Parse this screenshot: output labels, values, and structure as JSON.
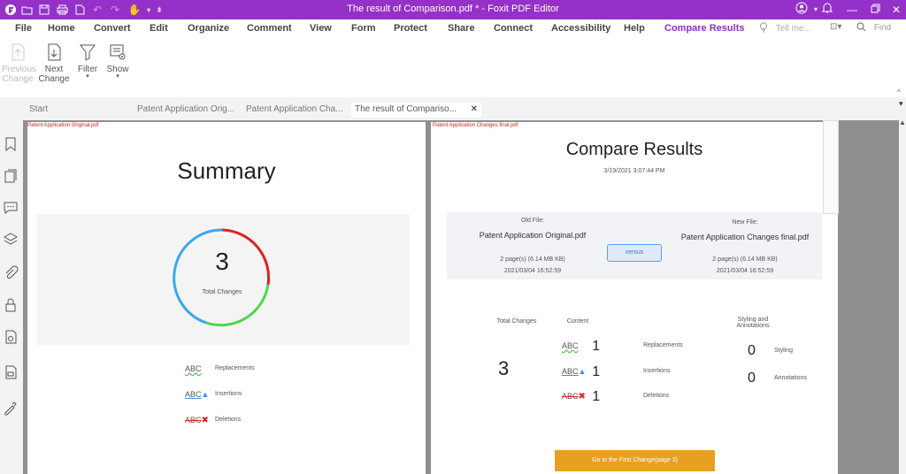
{
  "window": {
    "title": "The result of Comparison.pdf * - Foxit PDF Editor"
  },
  "menu": {
    "items": [
      "File",
      "Home",
      "Convert",
      "Edit",
      "Organize",
      "Comment",
      "View",
      "Form",
      "Protect",
      "Share",
      "Connect",
      "Accessibility",
      "Help",
      "Compare Results"
    ],
    "tell_me": "Tell me...",
    "find": "Find"
  },
  "ribbon": {
    "previous_change": [
      "Previous",
      "Change"
    ],
    "next_change": [
      "Next",
      "Change"
    ],
    "filter": "Filter",
    "show": "Show"
  },
  "tabs": [
    {
      "label": "Start"
    },
    {
      "label": "Patent Application Orig..."
    },
    {
      "label": "Patent Application Cha..."
    },
    {
      "label": "The result of Compariso..."
    }
  ],
  "page1": {
    "file_label": "Patent Application Original.pdf",
    "title": "Summary",
    "total": "3",
    "total_label": "Total Changes",
    "legend": [
      {
        "abc": "ABC",
        "label": "Replacements"
      },
      {
        "abc": "ABC",
        "label": "Insertions"
      },
      {
        "abc": "ABC",
        "label": "Deletions"
      }
    ],
    "colors": {
      "replacement": "#2ebd2e",
      "insertion": "#3a8ee6",
      "deletion": "#e02020"
    }
  },
  "page2": {
    "file_label": "Patent Application Changes final.pdf",
    "title": "Compare Results",
    "date": "3/19/2021 3:07:44 PM",
    "old_file": {
      "heading": "Old File:",
      "name": "Patent Application Original.pdf",
      "pages": "2 page(s) (6.14 MB KB)",
      "date": "2021/03/04 16:52:59"
    },
    "new_file": {
      "heading": "New File:",
      "name": "Patent Application Changes final.pdf",
      "pages": "2 page(s) (6.14 MB KB)",
      "date": "2021/03/04 16:52:59"
    },
    "versus": "versus",
    "total_changes_head": "Total Changes",
    "content_head": "Content",
    "styling_head": [
      "Styling and",
      "Annotations"
    ],
    "total": "3",
    "content": [
      {
        "abc": "ABC",
        "count": "1",
        "label": "Replacements"
      },
      {
        "abc": "ABC",
        "count": "1",
        "label": "Insertions"
      },
      {
        "abc": "ABC",
        "count": "1",
        "label": "Deletions"
      }
    ],
    "styling": [
      {
        "count": "0",
        "label": "Styling"
      },
      {
        "count": "0",
        "label": "Annotations"
      }
    ],
    "goto_button": "Go to the First Change(page 3)"
  }
}
